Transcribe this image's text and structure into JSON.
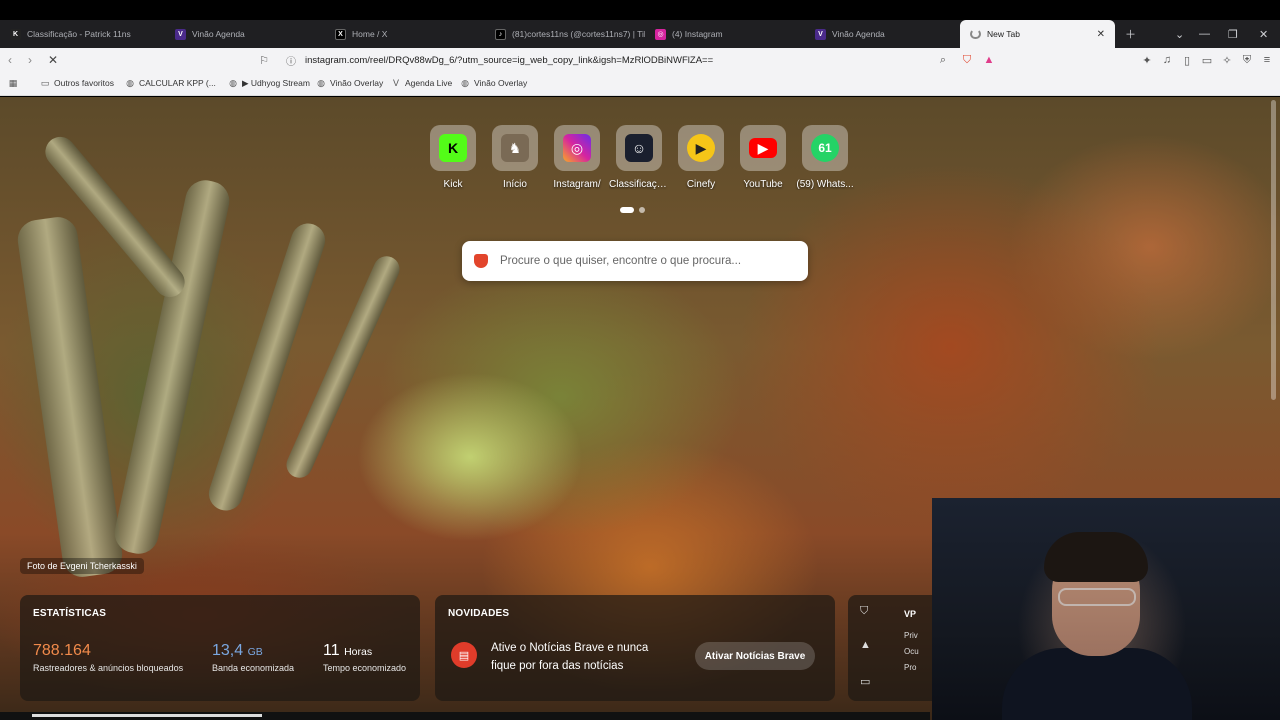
{
  "tabs": [
    {
      "title": "Classificação - Patrick 11ns",
      "icon": "kick-icon",
      "color": "#222222"
    },
    {
      "title": "Vinão Agenda",
      "icon": "vinao-icon",
      "color": "#4a2a8a"
    },
    {
      "title": "Home / X",
      "icon": "x-icon",
      "color": "#000000"
    },
    {
      "title": "(81)cortes11ns (@cortes11ns7) | Tik",
      "icon": "tiktok-icon",
      "color": "#000000"
    },
    {
      "title": "(4) Instagram",
      "icon": "instagram-icon",
      "color": "#d6249f"
    },
    {
      "title": "Vinão Agenda",
      "icon": "vinao-icon",
      "color": "#4a2a8a"
    },
    {
      "title": "New Tab",
      "icon": "loading-icon",
      "color": "#666666"
    }
  ],
  "address": {
    "url": "instagram.com/reel/DRQv88wDg_6/?utm_source=ig_web_copy_link&igsh=MzRlODBiNWFlZA=="
  },
  "bookmarks": [
    {
      "label": "Outros favoritos"
    },
    {
      "label": "CALCULAR KPP (..."
    },
    {
      "label": "▶ Udhyog Stream"
    },
    {
      "label": "Vinão Overlay"
    },
    {
      "label": "Agenda Live"
    },
    {
      "label": "Vinão Overlay"
    }
  ],
  "topsites": [
    {
      "label": "Kick",
      "glyph": "K",
      "color": "#53fc18",
      "fg": "#000000"
    },
    {
      "label": "Início",
      "glyph": "",
      "color": "#7a6a55",
      "fg": "#ffffff"
    },
    {
      "label": "Instagram/",
      "glyph": "◎",
      "color": "#d6249f",
      "fg": "#ffffff"
    },
    {
      "label": "Classificaçã...",
      "glyph": "",
      "color": "#1a1f2e",
      "fg": "#ffffff"
    },
    {
      "label": "Cinefy",
      "glyph": "▶",
      "color": "#f5c518",
      "fg": "#222222"
    },
    {
      "label": "YouTube",
      "glyph": "▶",
      "color": "#ff0000",
      "fg": "#ffffff"
    },
    {
      "label": "(59) Whats...",
      "glyph": "61",
      "color": "#25d366",
      "fg": "#ffffff"
    }
  ],
  "search": {
    "placeholder": "Procure o que quiser, encontre o que procura..."
  },
  "photo_credit": "Foto de Evgeni Tcherkasski",
  "stats": {
    "header": "ESTATÍSTICAS",
    "trackers_value": "788.164",
    "trackers_desc": "Rastreadores & anúncios bloqueados",
    "bandwidth_value": "13,4",
    "bandwidth_unit": "GB",
    "bandwidth_desc": "Banda economizada",
    "time_value": "11",
    "time_unit": "Horas",
    "time_desc": "Tempo economizado"
  },
  "news": {
    "header": "NOVIDADES",
    "text": "Ative o Notícias Brave e nunca fique por fora das notícias",
    "button": "Ativar Notícias Brave"
  },
  "vpn": {
    "label": "VP",
    "items": [
      "Priv",
      "Ocu",
      "Pro"
    ]
  },
  "colors": {
    "brave_accent": "#e2452c",
    "stat_orange": "#f08a4b",
    "stat_blue": "#7aa7e0"
  }
}
